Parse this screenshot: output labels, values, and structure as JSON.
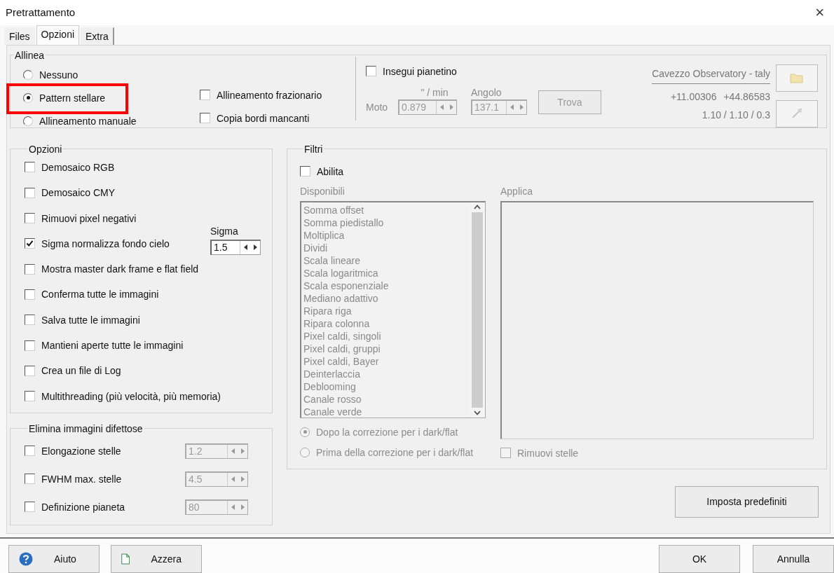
{
  "window": {
    "title": "Pretrattamento",
    "close": "×"
  },
  "tabs": [
    {
      "label": "Files",
      "selected": false
    },
    {
      "label": "Opzioni",
      "selected": true
    },
    {
      "label": "Extra",
      "selected": false
    }
  ],
  "allinea": {
    "title": "Allinea",
    "modes": [
      {
        "label": "Nessuno",
        "selected": false,
        "highlighted": false
      },
      {
        "label": "Pattern stellare",
        "selected": true,
        "highlighted": true
      },
      {
        "label": "Allineamento manuale",
        "selected": false,
        "highlighted": false
      }
    ],
    "options": [
      {
        "label": "Allineamento frazionario",
        "checked": false
      },
      {
        "label": "Copia bordi mancanti",
        "checked": false
      }
    ],
    "tracking": {
      "label": "Insegui pianetino",
      "checked": false,
      "disabled": true,
      "rate_unit": "\" / min",
      "motion_label": "Moto",
      "motion": "0.879",
      "angle_label": "Angolo",
      "angle": "137.1",
      "find": "Trova"
    },
    "observatory": {
      "name": "Cavezzo Observatory - taly",
      "longitude": "+11.00306",
      "latitude": "+44.86583",
      "scale": "1.10 / 1.10 / 0.3"
    }
  },
  "opzioni": {
    "title": "Opzioni",
    "items": [
      {
        "label": "Demosaico RGB",
        "checked": false
      },
      {
        "label": "Demosaico CMY",
        "checked": false
      },
      {
        "label": "Rimuovi pixel negativi",
        "checked": false
      },
      {
        "label": "Sigma normalizza fondo cielo",
        "checked": true,
        "spin": {
          "label": "Sigma",
          "value": "1.5"
        }
      },
      {
        "label": "Mostra master dark frame e flat field",
        "checked": false
      },
      {
        "label": "Conferma tutte le immagini",
        "checked": false
      },
      {
        "label": "Salva tutte le immagini",
        "checked": false
      },
      {
        "label": "Mantieni aperte tutte le immagini",
        "checked": false
      },
      {
        "label": "Crea un file di Log",
        "checked": false
      },
      {
        "label": "Multithreading (più velocità, più memoria)",
        "checked": false
      }
    ]
  },
  "elimina": {
    "title": "Elimina immagini difettose",
    "items": [
      {
        "label": "Elongazione stelle",
        "checked": false,
        "value": "1.2"
      },
      {
        "label": "FWHM max. stelle",
        "checked": false,
        "value": "4.5"
      },
      {
        "label": "Definizione pianeta",
        "checked": false,
        "value": "80"
      }
    ]
  },
  "filtri": {
    "title": "Filtri",
    "enable": {
      "label": "Abilita",
      "checked": false
    },
    "available_label": "Disponibili",
    "available": [
      "Somma offset",
      "Somma piedistallo",
      "Moltiplica",
      "Dividi",
      "Scala lineare",
      "Scala logaritmica",
      "Scala esponenziale",
      "Mediano adattivo",
      "Ripara riga",
      "Ripara colonna",
      "Pixel caldi, singoli",
      "Pixel caldi, gruppi",
      "Pixel caldi, Bayer",
      "Deinterlaccia",
      "Deblooming",
      "Canale rosso",
      "Canale verde"
    ],
    "apply_label": "Applica",
    "order": [
      {
        "label": "Dopo la correzione per i dark/flat",
        "selected": true
      },
      {
        "label": "Prima della correzione per i dark/flat",
        "selected": false
      }
    ],
    "remove_stars": {
      "label": "Rimuovi stelle",
      "checked": false
    }
  },
  "defaults_button": "Imposta predefiniti",
  "footer": [
    {
      "label": "Aiuto",
      "kind": "help"
    },
    {
      "label": "Azzera",
      "kind": "reset"
    },
    {
      "label": "OK",
      "kind": "ok"
    },
    {
      "label": "Annulla",
      "kind": "cancel"
    }
  ]
}
